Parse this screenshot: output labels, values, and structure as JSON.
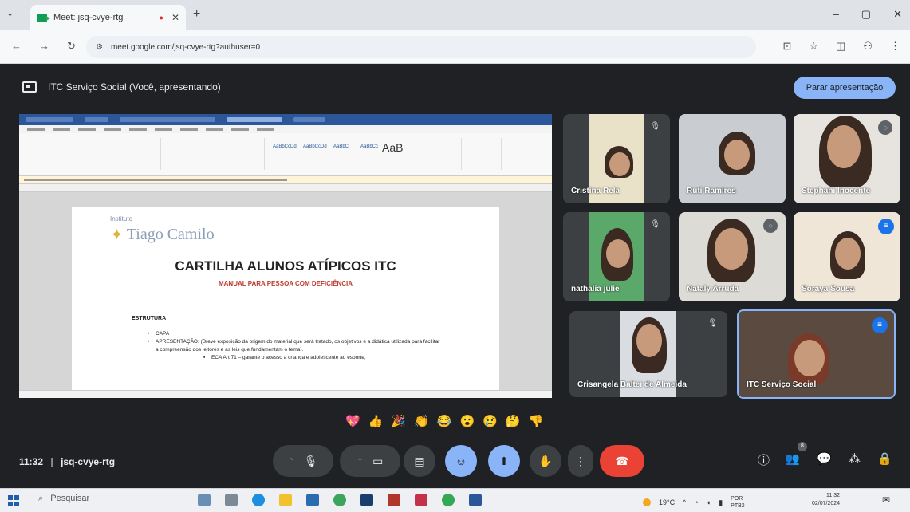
{
  "browser": {
    "tab_title": "Meet: jsq-cvye-rtg",
    "rec_indicator": "●",
    "tab_close": "✕",
    "new_tab": "+",
    "tab_list": "⌄",
    "url": "meet.google.com/jsq-cvye-rtg?authuser=0",
    "window_controls": {
      "minimize": "–",
      "maximize": "▢",
      "close": "✕"
    },
    "nav": {
      "back": "←",
      "forward": "→",
      "reload": "↻"
    },
    "right_icons": {
      "cast": "⊡",
      "star": "☆",
      "extensions": "◫",
      "profile": "⚇",
      "menu": "⋮"
    }
  },
  "meet": {
    "presenting_label": "ITC Serviço Social (Você, apresentando)",
    "stop_presenting_label": "Parar apresentação",
    "meeting_time": "11:32",
    "meeting_code": "jsq-cvye-rtg",
    "separator": "|",
    "participants": [
      {
        "name": "Cristina Rela"
      },
      {
        "name": "Ruti Ramires"
      },
      {
        "name": "Stephani Inocente"
      },
      {
        "name": "nathalia julie"
      },
      {
        "name": "Nataly Arruda"
      },
      {
        "name": "Soraya Sousa"
      },
      {
        "name": "Crisangela Baltei de Almeida"
      },
      {
        "name": "ITC Serviço Social"
      }
    ],
    "reactions": [
      "💖",
      "👍",
      "🎉",
      "👏",
      "😂",
      "😮",
      "😢",
      "🤔",
      "👎"
    ],
    "participant_count_badge": "8",
    "controls": {
      "caret": "⌃",
      "mic": "🎙",
      "camera": "▭",
      "captions": "▤",
      "emoji": "☺",
      "present": "⬆",
      "hand": "✋",
      "more": "⋮",
      "hangup": "☎"
    },
    "right_controls": {
      "info": "ⓘ",
      "people": "👥",
      "chat": "💬",
      "activities": "⁂",
      "host": "🔒"
    }
  },
  "shared_doc": {
    "institute_small": "Instituto",
    "institute_name": "Tiago Camilo",
    "title": "CARTILHA ALUNOS ATÍPICOS ITC",
    "subtitle": "MANUAL PARA PESSOA COM DEFICIÊNCIA",
    "section": "ESTRUTURA",
    "items": [
      "CAPA",
      "APRESENTAÇÃO: (Breve exposição da origem do material que será tratado, os objetivos e a didática utilizada para facilitar a compreensão dos leitores e as leis que fundamentam o tema)."
    ],
    "subitems": [
      "ECA Art 71 – garante o acesso a criança e adolescente ao esporte;"
    ],
    "ribbon_aab": "AaB",
    "bullet": "•",
    "logo_mark": "✦"
  },
  "taskbar": {
    "search_placeholder": "Pesquisar",
    "search_icon": "⌕",
    "weather": "19°C",
    "lang_line1": "POR",
    "lang_line2": "PTB2",
    "clock_time": "11:32",
    "clock_date": "02/07/2024",
    "tray_caret": "^"
  },
  "colors": {
    "meet_bg": "#202124",
    "accent_blue": "#8ab4f8",
    "hangup_red": "#ea4335"
  }
}
